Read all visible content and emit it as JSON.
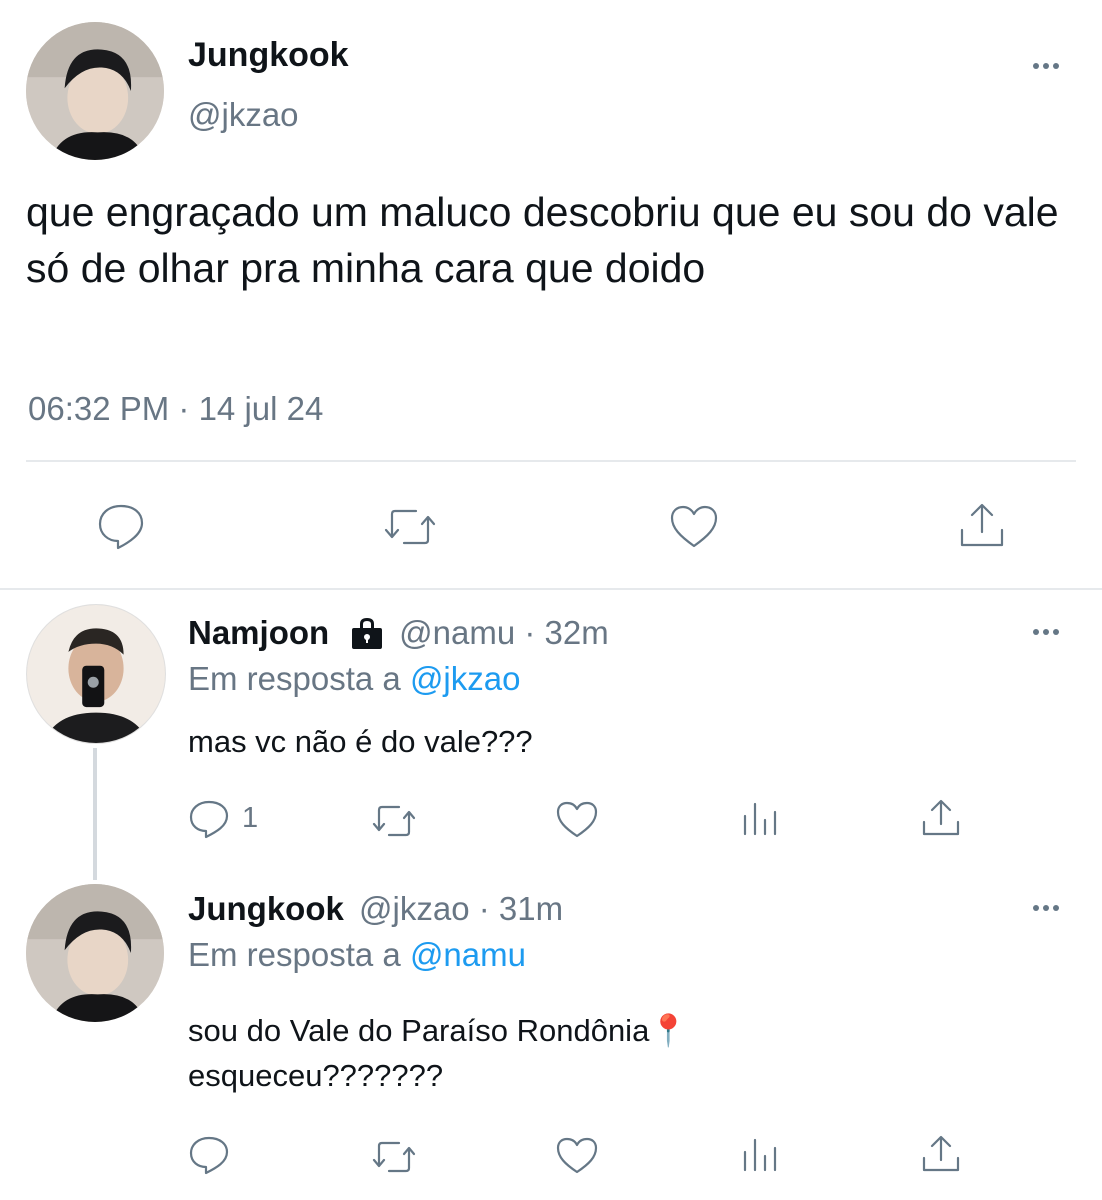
{
  "main_tweet": {
    "author_name": "Jungkook",
    "author_handle": "@jkzao",
    "text": "que engraçado um maluco descobriu que eu sou do vale só de olhar pra minha cara que doido",
    "timestamp": "06:32 PM · 14 jul 24"
  },
  "replies": [
    {
      "author_name": "Namjoon",
      "meta": "@namu · 32m",
      "reply_prefix": "Em resposta a",
      "reply_to": "@jkzao",
      "text": "mas vc não é do vale???",
      "reply_count": "1"
    },
    {
      "author_name": "Jungkook",
      "meta": "@jkzao · 31m",
      "reply_prefix": "Em resposta a",
      "reply_to": "@namu",
      "text_line1": "sou do Vale do Paraíso Rondônia📍",
      "text_line2": "esqueceu???????"
    }
  ],
  "icons": {
    "reply": "reply-icon",
    "retweet": "retweet-icon",
    "like": "like-icon",
    "views": "views-icon",
    "share": "share-icon",
    "more": "more-icon",
    "lock": "lock-icon"
  },
  "colors": {
    "text": "#0f1419",
    "muted": "#687684",
    "link": "#1d9bf0",
    "icon": "#657786",
    "divider": "#e6e9ec"
  }
}
